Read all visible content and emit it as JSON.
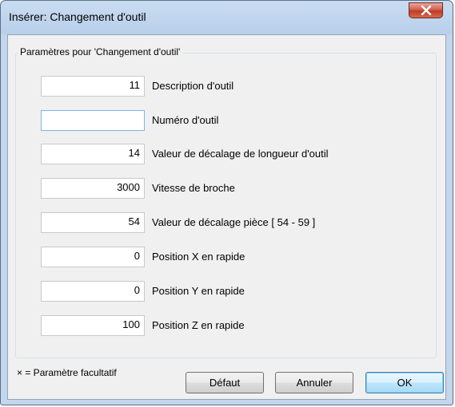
{
  "window": {
    "title": "Insérer: Changement d'outil"
  },
  "group": {
    "legend": "Paramètres pour 'Changement d'outil'"
  },
  "fields": [
    {
      "value": "11",
      "label": "Description d'outil"
    },
    {
      "value": "",
      "label": "Numéro d'outil"
    },
    {
      "value": "14",
      "label": "Valeur de décalage de longueur d'outil"
    },
    {
      "value": "3000",
      "label": "Vitesse de broche"
    },
    {
      "value": "54",
      "label": "Valeur de décalage pièce  [ 54 - 59 ]"
    },
    {
      "value": "0",
      "label": "Position X en rapide"
    },
    {
      "value": "0",
      "label": "Position Y en rapide"
    },
    {
      "value": "100",
      "label": "Position Z en rapide"
    }
  ],
  "footer": {
    "note": "× =  Paramètre facultatif",
    "default_label": "Défaut",
    "cancel_label": "Annuler",
    "ok_label": "OK"
  },
  "icons": {
    "close": "close-icon"
  },
  "colors": {
    "title_bar": "#b9d0ea",
    "close_button": "#c13a26",
    "dialog_bg": "#f0f0f0"
  }
}
